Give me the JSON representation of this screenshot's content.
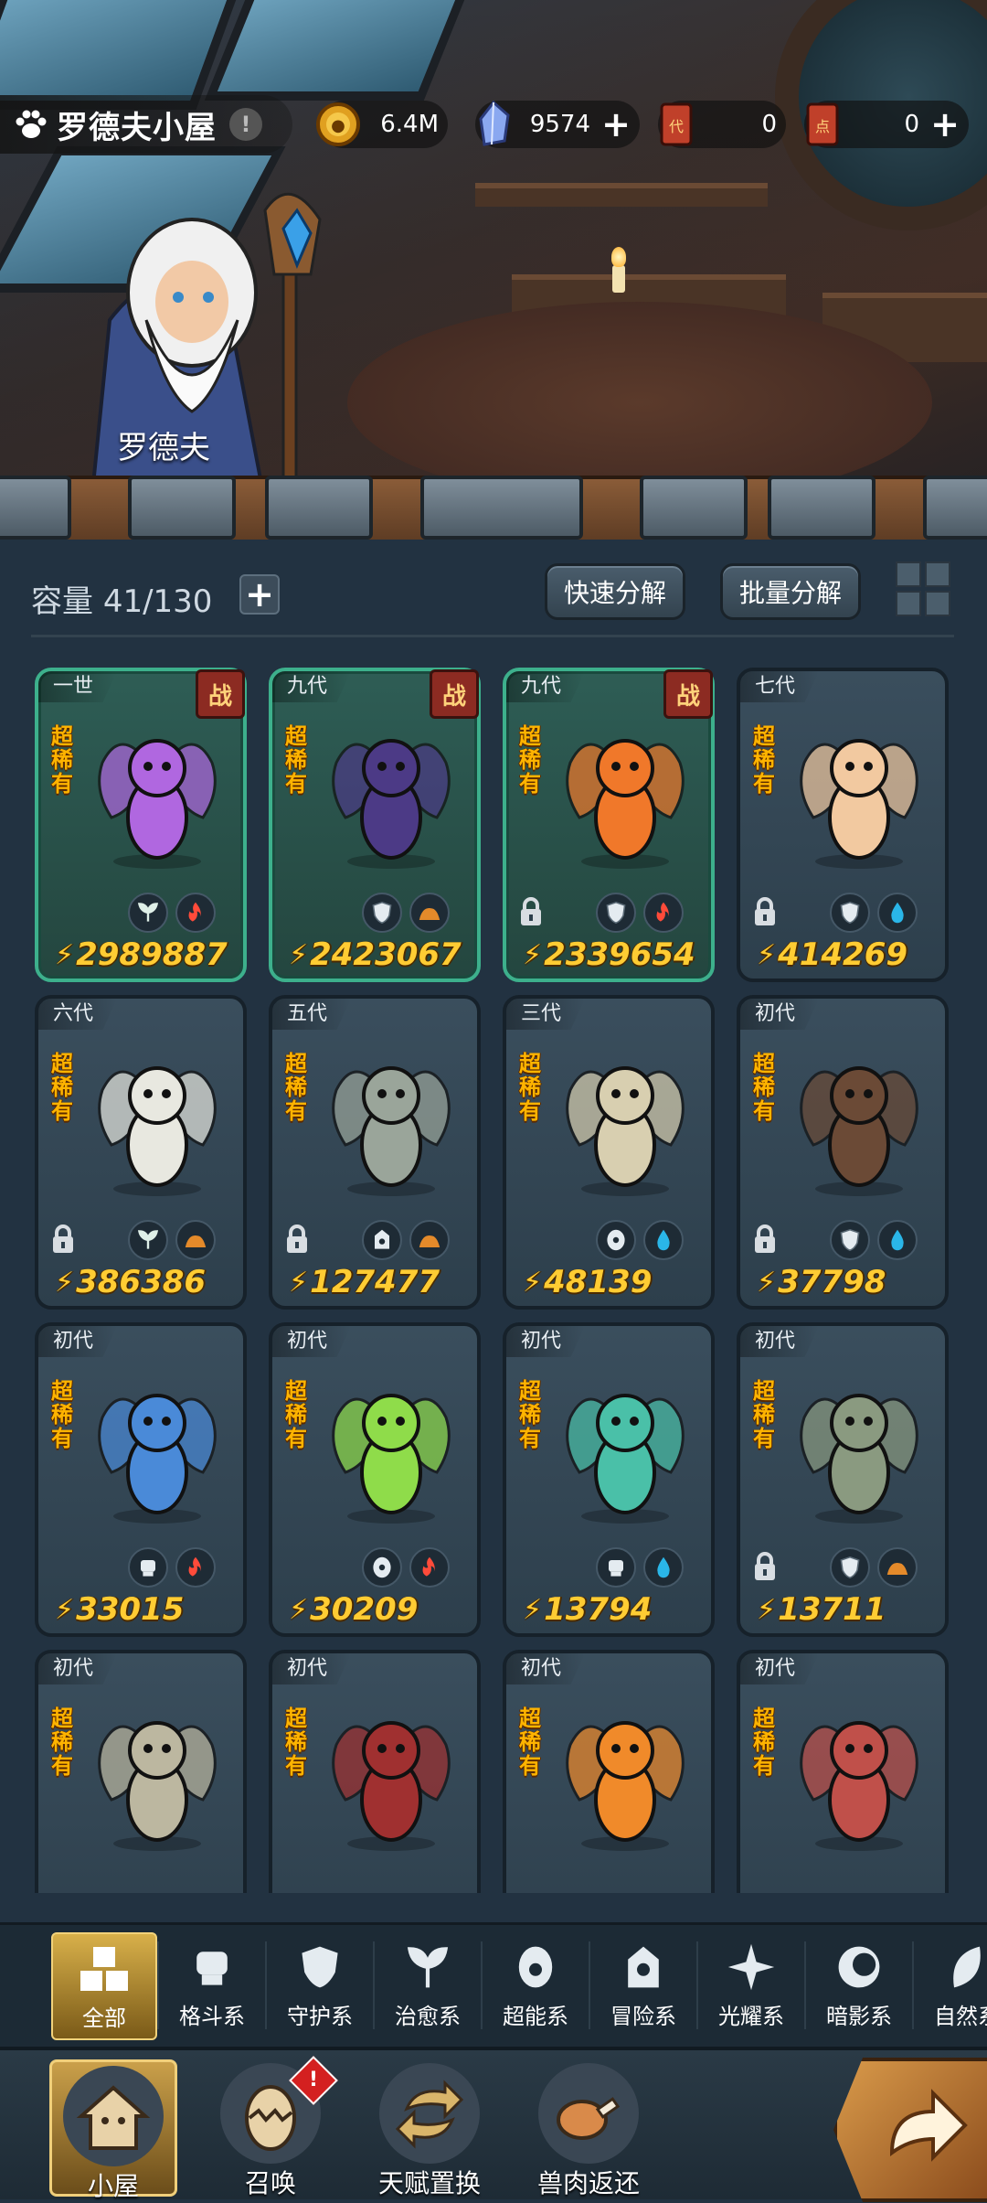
{
  "header": {
    "location_title": "罗德夫小屋",
    "npc_name": "罗德夫"
  },
  "resources": [
    {
      "name": "gold-coin",
      "value": "6.4M",
      "has_plus": false
    },
    {
      "name": "crystal",
      "value": "9574",
      "has_plus": true
    },
    {
      "name": "ticket-dai",
      "value": "0",
      "has_plus": false,
      "glyph": "代"
    },
    {
      "name": "ticket-dian",
      "value": "0",
      "has_plus": true,
      "glyph": "点"
    }
  ],
  "storage": {
    "capacity_label": "容量",
    "capacity_value": "41/130",
    "quick_decompose": "快速分解",
    "batch_decompose": "批量分解"
  },
  "cards": [
    {
      "gen": "一世",
      "battle": true,
      "battle_label": "战",
      "rarity": "超稀有",
      "power": "2989887",
      "locked": false,
      "green": true,
      "elements": [
        "heal",
        "fire"
      ],
      "creature": "pink-fairy",
      "color": "#b067e0"
    },
    {
      "gen": "九代",
      "battle": true,
      "battle_label": "战",
      "rarity": "超稀有",
      "power": "2423067",
      "locked": false,
      "green": true,
      "elements": [
        "guard",
        "earth"
      ],
      "creature": "dark-witch",
      "color": "#4c3a86"
    },
    {
      "gen": "九代",
      "battle": true,
      "battle_label": "战",
      "rarity": "超稀有",
      "power": "2339654",
      "locked": true,
      "green": true,
      "elements": [
        "guard",
        "fire"
      ],
      "creature": "fire-spirit",
      "color": "#f0782a"
    },
    {
      "gen": "七代",
      "battle": false,
      "rarity": "超稀有",
      "power": "414269",
      "locked": true,
      "green": false,
      "elements": [
        "guard",
        "water"
      ],
      "creature": "bunny-mage",
      "color": "#f2c9a0"
    },
    {
      "gen": "六代",
      "battle": false,
      "rarity": "超稀有",
      "power": "386386",
      "locked": true,
      "green": false,
      "elements": [
        "heal",
        "earth"
      ],
      "creature": "owl-priest",
      "color": "#e8e8e0"
    },
    {
      "gen": "五代",
      "battle": false,
      "rarity": "超稀有",
      "power": "127477",
      "locked": true,
      "green": false,
      "elements": [
        "adventure",
        "earth"
      ],
      "creature": "armored-rat",
      "color": "#9aa59a"
    },
    {
      "gen": "三代",
      "battle": false,
      "rarity": "超稀有",
      "power": "48139",
      "locked": false,
      "green": false,
      "elements": [
        "psychic",
        "water"
      ],
      "creature": "sea-serpent",
      "color": "#d8cfb0"
    },
    {
      "gen": "初代",
      "battle": false,
      "rarity": "超稀有",
      "power": "37798",
      "locked": true,
      "green": false,
      "elements": [
        "guard",
        "water"
      ],
      "creature": "forest-druid",
      "color": "#6b4a36"
    },
    {
      "gen": "初代",
      "battle": false,
      "rarity": "超稀有",
      "power": "33015",
      "locked": false,
      "green": false,
      "elements": [
        "fight",
        "fire"
      ],
      "creature": "blue-flame-cat",
      "color": "#4a8ad8"
    },
    {
      "gen": "初代",
      "battle": false,
      "rarity": "超稀有",
      "power": "30209",
      "locked": false,
      "green": false,
      "elements": [
        "psychic",
        "fire"
      ],
      "creature": "hammer-lizard",
      "color": "#8fdc4a"
    },
    {
      "gen": "初代",
      "battle": false,
      "rarity": "超稀有",
      "power": "13794",
      "locked": false,
      "green": false,
      "elements": [
        "fight",
        "water"
      ],
      "creature": "water-wave",
      "color": "#4ac0a8"
    },
    {
      "gen": "初代",
      "battle": false,
      "rarity": "超稀有",
      "power": "13711",
      "locked": true,
      "green": false,
      "elements": [
        "guard",
        "earth"
      ],
      "creature": "mantis-knight",
      "color": "#8a9a80"
    },
    {
      "gen": "初代",
      "battle": false,
      "rarity": "超稀有",
      "power": "",
      "locked": false,
      "green": false,
      "elements": [],
      "creature": "skeleton-dragon",
      "color": "#bcb7a0"
    },
    {
      "gen": "初代",
      "battle": false,
      "rarity": "超稀有",
      "power": "",
      "locked": false,
      "green": false,
      "elements": [],
      "creature": "dark-beast",
      "color": "#a03030"
    },
    {
      "gen": "初代",
      "battle": false,
      "rarity": "超稀有",
      "power": "",
      "locked": false,
      "green": false,
      "elements": [],
      "creature": "phoenix-fairy",
      "color": "#f08a2a"
    },
    {
      "gen": "初代",
      "battle": false,
      "rarity": "超稀有",
      "power": "",
      "locked": false,
      "green": false,
      "elements": [],
      "creature": "cyclops-blob",
      "color": "#c0504a"
    }
  ],
  "categories": [
    {
      "label": "全部",
      "icon": "all-icon",
      "active": true
    },
    {
      "label": "格斗系",
      "icon": "fight-icon",
      "active": false
    },
    {
      "label": "守护系",
      "icon": "guard-icon",
      "active": false
    },
    {
      "label": "治愈系",
      "icon": "heal-icon",
      "active": false
    },
    {
      "label": "超能系",
      "icon": "psychic-icon",
      "active": false
    },
    {
      "label": "冒险系",
      "icon": "adventure-icon",
      "active": false
    },
    {
      "label": "光耀系",
      "icon": "light-icon",
      "active": false
    },
    {
      "label": "暗影系",
      "icon": "shadow-icon",
      "active": false
    },
    {
      "label": "自然系",
      "icon": "nature-icon",
      "active": false
    }
  ],
  "bottom_nav": [
    {
      "label": "小屋",
      "icon": "house-icon",
      "active": true,
      "badge": ""
    },
    {
      "label": "召唤",
      "icon": "egg-icon",
      "active": false,
      "badge": "!"
    },
    {
      "label": "天赋置换",
      "icon": "swap-icon",
      "active": false,
      "badge": ""
    },
    {
      "label": "兽肉返还",
      "icon": "meat-icon",
      "active": false,
      "badge": ""
    }
  ],
  "colors": {
    "accent_gold": "#ffcc33",
    "rarity_orange": "#ffb400",
    "battle_red": "#8c2b22",
    "team_green": "#3db08c"
  }
}
